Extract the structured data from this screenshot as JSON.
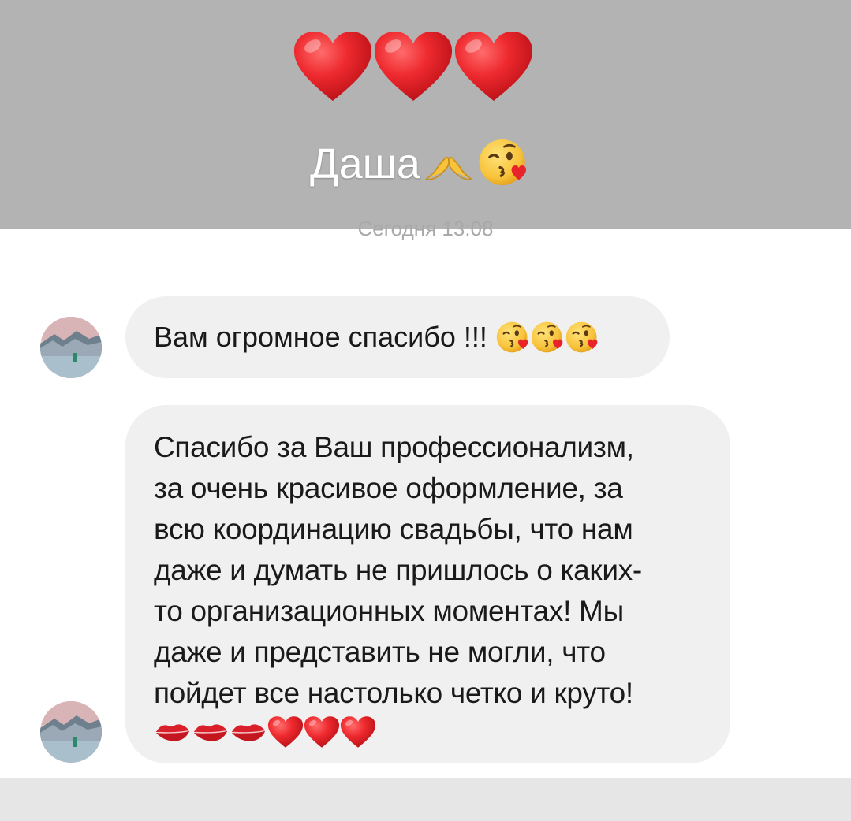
{
  "header": {
    "hearts": [
      "red-heart",
      "red-heart",
      "red-heart"
    ],
    "title": "Даша",
    "title_emojis": [
      "heart-hands",
      "face-blowing-kiss"
    ],
    "background_color": "#b3b3b3"
  },
  "timestamp": "Сегодня 13:08",
  "messages": [
    {
      "text": "Вам огромное спасибо !!!",
      "emojis": [
        "face-blowing-kiss",
        "face-blowing-kiss",
        "face-blowing-kiss"
      ]
    },
    {
      "lines": [
        "Спасибо за Ваш профессионализм,",
        "за очень красивое оформление, за",
        "всю координацию свадьбы, что нам",
        "даже и думать не пришлось о каких-",
        "то организационных моментах! Мы",
        "даже и представить  не могли, что",
        "пойдет все настолько четко и круто!"
      ],
      "emojis": [
        "kiss-mark",
        "kiss-mark",
        "kiss-mark",
        "red-heart",
        "red-heart",
        "red-heart"
      ]
    }
  ],
  "colors": {
    "bubble": "#f0f0f0",
    "heart": "#e8232a",
    "timestamp": "#a9a9a9"
  }
}
